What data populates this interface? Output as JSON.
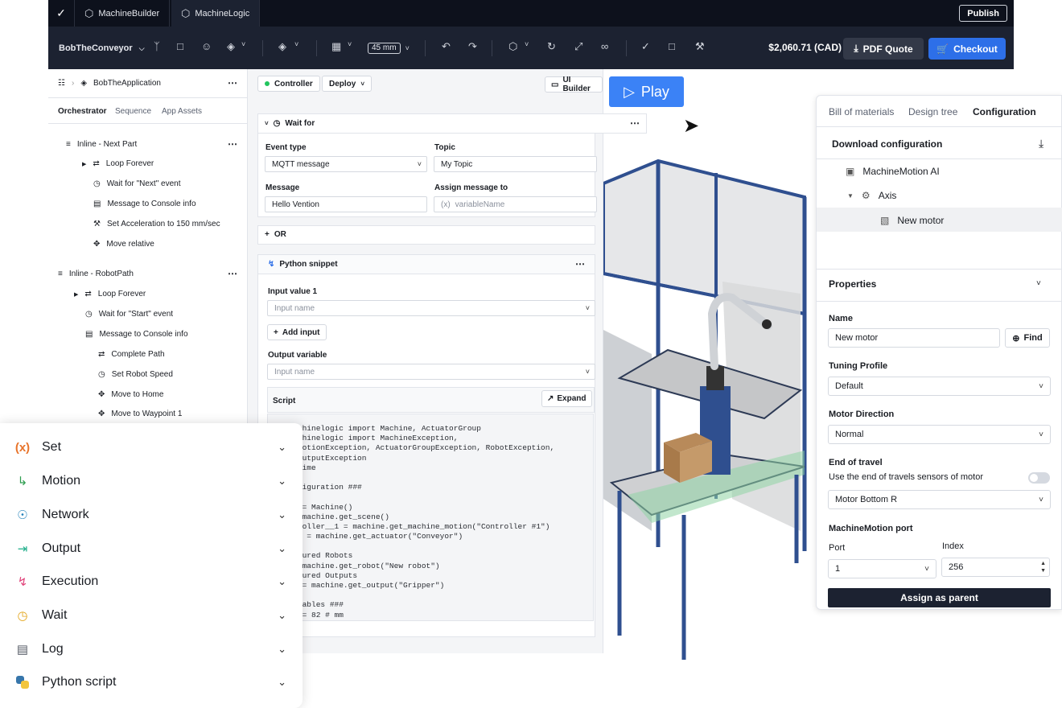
{
  "topbar": {
    "tabs": [
      {
        "label": "MachineBuilder"
      },
      {
        "label": "MachineLogic"
      }
    ],
    "publish_label": "Publish"
  },
  "toolbar": {
    "project_name": "BobTheConveyor",
    "zoom_value": "45 mm",
    "price": "$2,060.71 (CAD)",
    "pdf_quote_label": "PDF Quote",
    "checkout_label": "Checkout"
  },
  "left_panel": {
    "breadcrumb": "BobTheApplication",
    "tabs": [
      "Orchestrator",
      "Sequence",
      "App Assets"
    ],
    "tree": [
      {
        "label": "Inline - Next Part",
        "icon": "inline-icon"
      },
      {
        "label": "Loop Forever",
        "icon": "loop-icon"
      },
      {
        "label": "Wait for \"Next\" event",
        "icon": "clock-icon"
      },
      {
        "label": "Message to Console info",
        "icon": "message-icon"
      },
      {
        "label": "Set Acceleration to 150 mm/sec",
        "icon": "wrench-icon"
      },
      {
        "label": "Move relative",
        "icon": "move-icon"
      },
      {
        "label": "Inline - RobotPath",
        "icon": "inline-icon"
      },
      {
        "label": "Loop Forever",
        "icon": "loop-icon"
      },
      {
        "label": "Wait for \"Start\" event",
        "icon": "clock-icon"
      },
      {
        "label": "Message to Console info",
        "icon": "message-icon"
      },
      {
        "label": "Complete Path",
        "icon": "path-icon"
      },
      {
        "label": "Set Robot Speed",
        "icon": "speed-icon"
      },
      {
        "label": "Move to Home",
        "icon": "move-icon"
      },
      {
        "label": "Move to Waypoint 1",
        "icon": "move-icon"
      }
    ]
  },
  "editor": {
    "controller_label": "Controller",
    "deploy_label": "Deploy",
    "ui_builder_label": "UI Builder",
    "wait_for": {
      "title": "Wait for",
      "event_type_label": "Event type",
      "event_type_value": "MQTT message",
      "topic_label": "Topic",
      "topic_value": "My Topic",
      "message_label": "Message",
      "message_value": "Hello Vention",
      "assign_label": "Assign message to",
      "assign_prefix": "(x)",
      "assign_placeholder": "variableName",
      "or_label": "OR"
    },
    "python": {
      "title": "Python snippet",
      "input_label": "Input value 1",
      "input_placeholder": "Input name",
      "add_input_label": "Add input",
      "output_label": "Output variable",
      "output_placeholder": "Input name",
      "script_label": "Script",
      "expand_label": "Expand",
      "code_lines": [
        "from machinelogic import Machine, ActuatorGroup",
        "from machinelogic import MachineException,",
        "MachineMotionException, ActuatorGroupException, RobotException,",
        "DigitalOutputException",
        "import time",
        "",
        "### Configuration ###",
        "",
        "machine = Machine()",
        "scene = machine.get_scene()",
        "my_controller__1 = machine.get_machine_motion(\"Controller #1\")",
        "conveyor = machine.get_actuator(\"Conveyor\")",
        "",
        "# Configured Robots",
        "robot = machine.get_robot(\"New robot\")",
        "# Configured Outputs",
        "gripper = machine.get_output(\"Gripper\")",
        "",
        "### Variables ###",
        "spacing = 82 # mm"
      ]
    }
  },
  "play_label": "Play",
  "right_panel": {
    "tabs": [
      "Bill of materials",
      "Design tree",
      "Configuration"
    ],
    "download_label": "Download configuration",
    "tree": [
      {
        "label": "MachineMotion AI",
        "icon": "chip-icon"
      },
      {
        "label": "Axis",
        "icon": "axis-icon"
      },
      {
        "label": "New motor",
        "icon": "motor-icon"
      }
    ],
    "properties_label": "Properties",
    "name_label": "Name",
    "name_value": "New motor",
    "find_label": "Find",
    "tuning_label": "Tuning Profile",
    "tuning_value": "Default",
    "direction_label": "Motor Direction",
    "direction_value": "Normal",
    "end_travel_label": "End of travel",
    "end_travel_text": "Use the end of travels sensors of motor",
    "end_travel_sensor": "Motor Bottom R",
    "port_section_label": "MachineMotion port",
    "port_label": "Port",
    "port_value": "1",
    "index_label": "Index",
    "index_value": "256",
    "assign_parent_label": "Assign as parent"
  },
  "categories": [
    {
      "label": "Set",
      "icon": "variable-icon",
      "color": "#e8742b"
    },
    {
      "label": "Motion",
      "icon": "motion-icon",
      "color": "#2e9d4f"
    },
    {
      "label": "Network",
      "icon": "network-icon",
      "color": "#1f7fb8"
    },
    {
      "label": "Output",
      "icon": "output-icon",
      "color": "#1fae8a"
    },
    {
      "label": "Execution",
      "icon": "lightning-icon",
      "color": "#e0457b"
    },
    {
      "label": "Wait",
      "icon": "alarm-icon",
      "color": "#e3a51a"
    },
    {
      "label": "Log",
      "icon": "log-icon",
      "color": "#555b66"
    },
    {
      "label": "Python script",
      "icon": "python-icon",
      "color": "#3776ab"
    }
  ]
}
